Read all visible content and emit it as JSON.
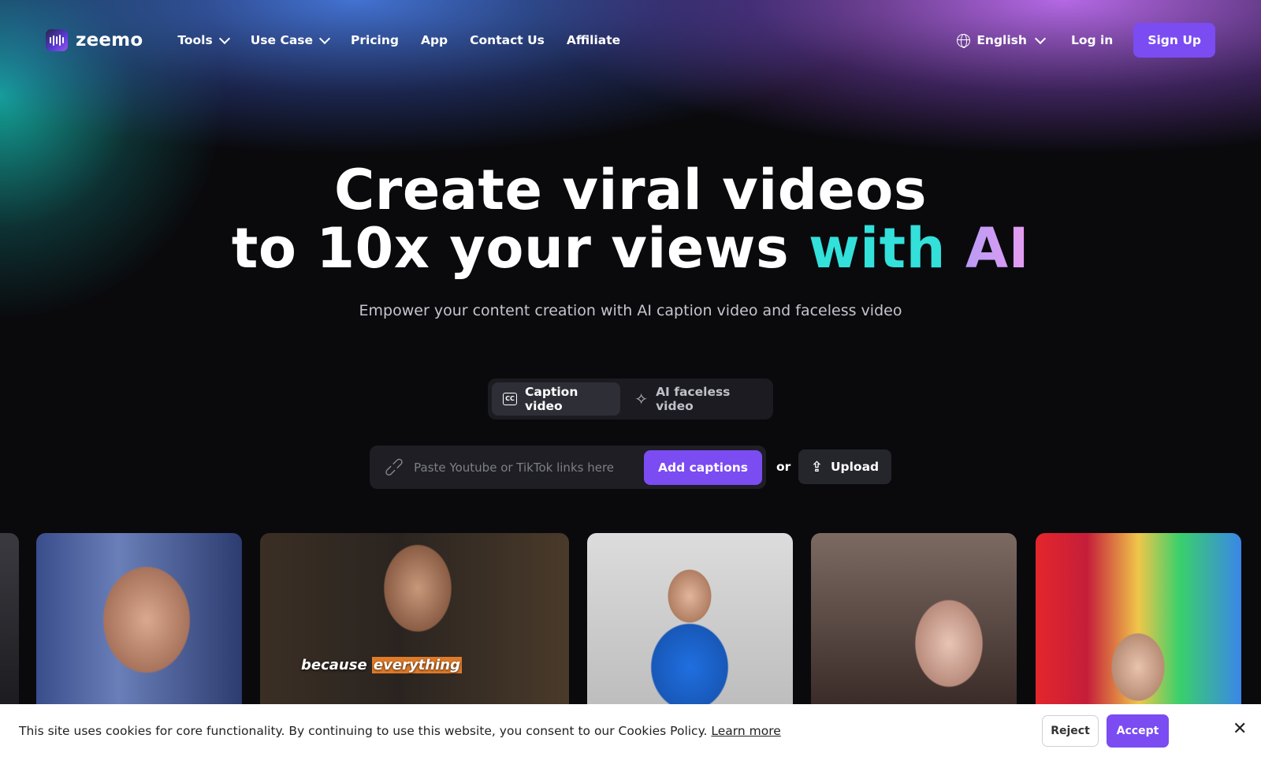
{
  "nav": {
    "logo_text": "zeemo",
    "links": [
      {
        "label": "Tools",
        "has_dropdown": true
      },
      {
        "label": "Use Case",
        "has_dropdown": true
      },
      {
        "label": "Pricing"
      },
      {
        "label": "App"
      },
      {
        "label": "Contact Us"
      },
      {
        "label": "Affiliate"
      }
    ],
    "language": "English",
    "login_label": "Log in",
    "signup_label": "Sign Up"
  },
  "hero": {
    "title_line1": "Create viral videos",
    "title_line2_a": "to 10x your views ",
    "title_with": "with",
    "title_ai": "AI",
    "subtitle": "Empower your content creation with AI caption video and faceless video"
  },
  "mode_tabs": [
    {
      "label": "Caption video",
      "icon": "closed-captions-icon",
      "active": true
    },
    {
      "label": "AI faceless video",
      "icon": "sparkle-icon",
      "active": false
    }
  ],
  "link_input": {
    "placeholder": "Paste Youtube or TikTok links here",
    "value": "",
    "submit_label": "Add captions"
  },
  "or_label": "or",
  "upload_label": "Upload",
  "thumbnails": [
    {
      "caption_before": "because ",
      "caption_highlight": "everything"
    }
  ],
  "cookie": {
    "text": "This site uses cookies for core functionality. By continuing to use this website, you consent to our Cookies Policy. ",
    "learn_more": "Learn more",
    "reject_label": "Reject",
    "accept_label": "Accept"
  },
  "colors": {
    "accent": "#7b4cf2",
    "highlight_teal": "#33e0da",
    "background": "#0a0a0d"
  }
}
